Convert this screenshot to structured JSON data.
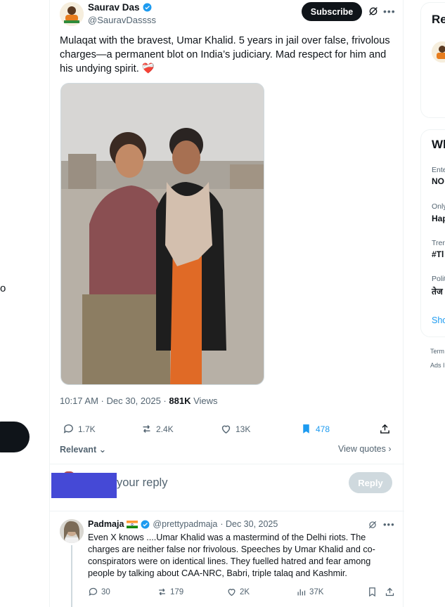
{
  "left_rail": {
    "cut_letter": "o"
  },
  "post": {
    "author_name": "Saurav Das",
    "handle": "@SauravDassss",
    "subscribe_label": "Subscribe",
    "text": "Mulaqat with the bravest, Umar Khalid. 5 years in jail over false, frivolous charges—a permanent blot on India’s judiciary. Mad respect for him and his undying spirit. ❤️‍🩹",
    "timestamp": "10:17 AM · Dec 30, 2025 · ",
    "views_count": "881K",
    "views_label": " Views",
    "stats": {
      "replies": "1.7K",
      "reposts": "2.4K",
      "likes": "13K",
      "bookmarks": "478"
    },
    "relevant_label": "Relevant",
    "view_quotes_label": "View quotes"
  },
  "reply_box": {
    "placeholder": "your reply",
    "button_label": "Reply"
  },
  "comment": {
    "name": "Padmaja",
    "handle": "@prettypadmaja",
    "date": "· Dec 30, 2025",
    "text": "Even X knows ....Umar Khalid was a mastermind of the Delhi riots. The charges are neither false nor frivolous. Speeches by Umar Khalid and co-conspirators were on identical lines. They fuelled hatred and fear among people by talking about CAA-NRC, Babri, triple talaq and Kashmir.",
    "stats": {
      "replies": "30",
      "reposts": "179",
      "likes": "2K",
      "views": "37K"
    }
  },
  "right_rail": {
    "card1_title": "Re",
    "card2_title": "Wh",
    "trends": [
      {
        "context": "Ente",
        "name": "NO"
      },
      {
        "context": "Only",
        "name": "Hap"
      },
      {
        "context": "Tren",
        "name": "#Tl"
      },
      {
        "context": "Polit",
        "name": "तेज"
      }
    ],
    "show_more": "Sho",
    "footer_terms": "Term",
    "footer_ads": "Ads I"
  },
  "colors": {
    "accent": "#1d9bf0",
    "text": "#0f1419",
    "muted": "#536471",
    "redaction": "#4549d6"
  },
  "icons": [
    "verified-badge-icon",
    "grok-icon",
    "more-icon",
    "reply-icon",
    "repost-icon",
    "like-icon",
    "bookmark-icon",
    "share-icon",
    "views-icon",
    "india-flag-icon",
    "chevron-down-icon",
    "chevron-right-icon"
  ]
}
